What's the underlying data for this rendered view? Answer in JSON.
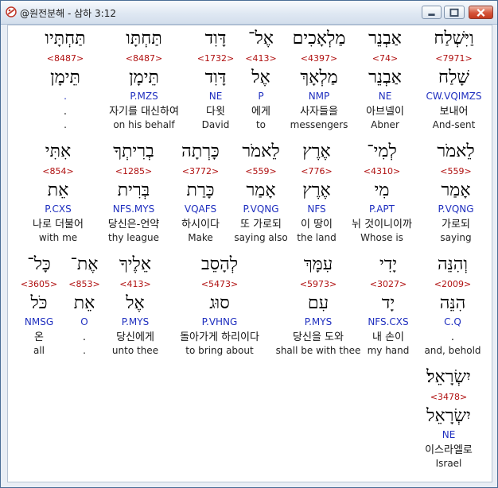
{
  "window": {
    "title": "@원전분해 - 삼하 3:12",
    "minimize_label": "minimize",
    "maximize_label": "maximize",
    "close_label": "close"
  },
  "rows": [
    [
      {
        "heb": "וַיִּשְׁלַח",
        "strong": "<7971>",
        "lemma": "שָׁלַח",
        "morph": "CW.VQIMZS",
        "kor": "보내어",
        "eng": "And-sent"
      },
      {
        "heb": "אַבְנֵר",
        "strong": "<74>",
        "lemma": "אַבְנֵר",
        "morph": "NE",
        "kor": "아브넬이",
        "eng": "Abner"
      },
      {
        "heb": "מַלְאָכִים",
        "strong": "<4397>",
        "lemma": "מַלְאָךְ",
        "morph": "NMP",
        "kor": "사자들을",
        "eng": "messengers"
      },
      {
        "heb": "אֶל־",
        "strong": "<413>",
        "lemma": "אֶל",
        "morph": "P",
        "kor": "에게",
        "eng": "to"
      },
      {
        "heb": "דָּוִד",
        "strong": "<1732>",
        "lemma": "דָּוִד",
        "morph": "NE",
        "kor": "다윗",
        "eng": "David"
      },
      {
        "heb": "תַּחְתָּו",
        "strong": "<8487>",
        "lemma": "תֵּימָן",
        "morph": "P.MZS",
        "kor": "자기를 대신하여",
        "eng": "on his behalf"
      },
      {
        "heb": "תַּחְתָּיו",
        "strong": "<8487>",
        "lemma": "תֵּימָן",
        "morph": ".",
        "kor": ".",
        "eng": "."
      }
    ],
    [
      {
        "heb": "לֵאמֹר",
        "strong": "<559>",
        "lemma": "אָמַר",
        "morph": "P.VQNG",
        "kor": "가로되",
        "eng": "saying"
      },
      {
        "heb": "לְמִי־",
        "strong": "<4310>",
        "lemma": "מִי",
        "morph": "P.APT",
        "kor": "뉘 것이니이까",
        "eng": "Whose is"
      },
      {
        "heb": "אֶרֶץ",
        "strong": "<776>",
        "lemma": "אֶרֶץ",
        "morph": "NFS",
        "kor": "이 땅이",
        "eng": "the land"
      },
      {
        "heb": "לֵאמֹר",
        "strong": "<559>",
        "lemma": "אָמַר",
        "morph": "P.VQNG",
        "kor": "또 가로되",
        "eng": "saying also"
      },
      {
        "heb": "כָּרְתָה",
        "strong": "<3772>",
        "lemma": "כָּרַת",
        "morph": "VQAFS",
        "kor": "하시이다",
        "eng": "Make"
      },
      {
        "heb": "בְרִיתְךָ",
        "strong": "<1285>",
        "lemma": "בְּרִית",
        "morph": "NFS.MYS",
        "kor": "당신은-언약",
        "eng": "thy league"
      },
      {
        "heb": "אִתִּי",
        "strong": "<854>",
        "lemma": "אֵת",
        "morph": "P.CXS",
        "kor": "나로 더불어",
        "eng": "with me"
      }
    ],
    [
      {
        "heb": "וְהִנֵּה",
        "strong": "<2009>",
        "lemma": "הִנֵּה",
        "morph": "C.Q",
        "kor": ".",
        "eng": "and, behold"
      },
      {
        "heb": "יָדִי",
        "strong": "<3027>",
        "lemma": "יָד",
        "morph": "NFS.CXS",
        "kor": "내 손이",
        "eng": "my hand"
      },
      {
        "heb": "עִמָּךְ",
        "strong": "<5973>",
        "lemma": "עִם",
        "morph": "P.MYS",
        "kor": "당신을 도와",
        "eng": "shall be with thee"
      },
      {
        "heb": "לְהָסֵב",
        "strong": "<5473>",
        "lemma": "סוּג",
        "morph": "P.VHNG",
        "kor": "돌아가게 하리이다",
        "eng": "to bring about"
      },
      {
        "heb": "אֵלֶיךָ",
        "strong": "<413>",
        "lemma": "אֶל",
        "morph": "P.MYS",
        "kor": "당신에게",
        "eng": "unto thee"
      },
      {
        "heb": "אֶת־",
        "strong": "<853>",
        "lemma": "אֵת",
        "morph": "O",
        "kor": ".",
        "eng": "."
      },
      {
        "heb": "כָּל־",
        "strong": "<3605>",
        "lemma": "כֹּל",
        "morph": "NMSG",
        "kor": "온",
        "eng": "all"
      }
    ],
    [
      {
        "heb": "יִשְׂרָאֵל׃",
        "strong": "<3478>",
        "lemma": "יִשְׂרָאֵל",
        "morph": "NE",
        "kor": "이스라엘로",
        "eng": "Israel"
      }
    ]
  ]
}
